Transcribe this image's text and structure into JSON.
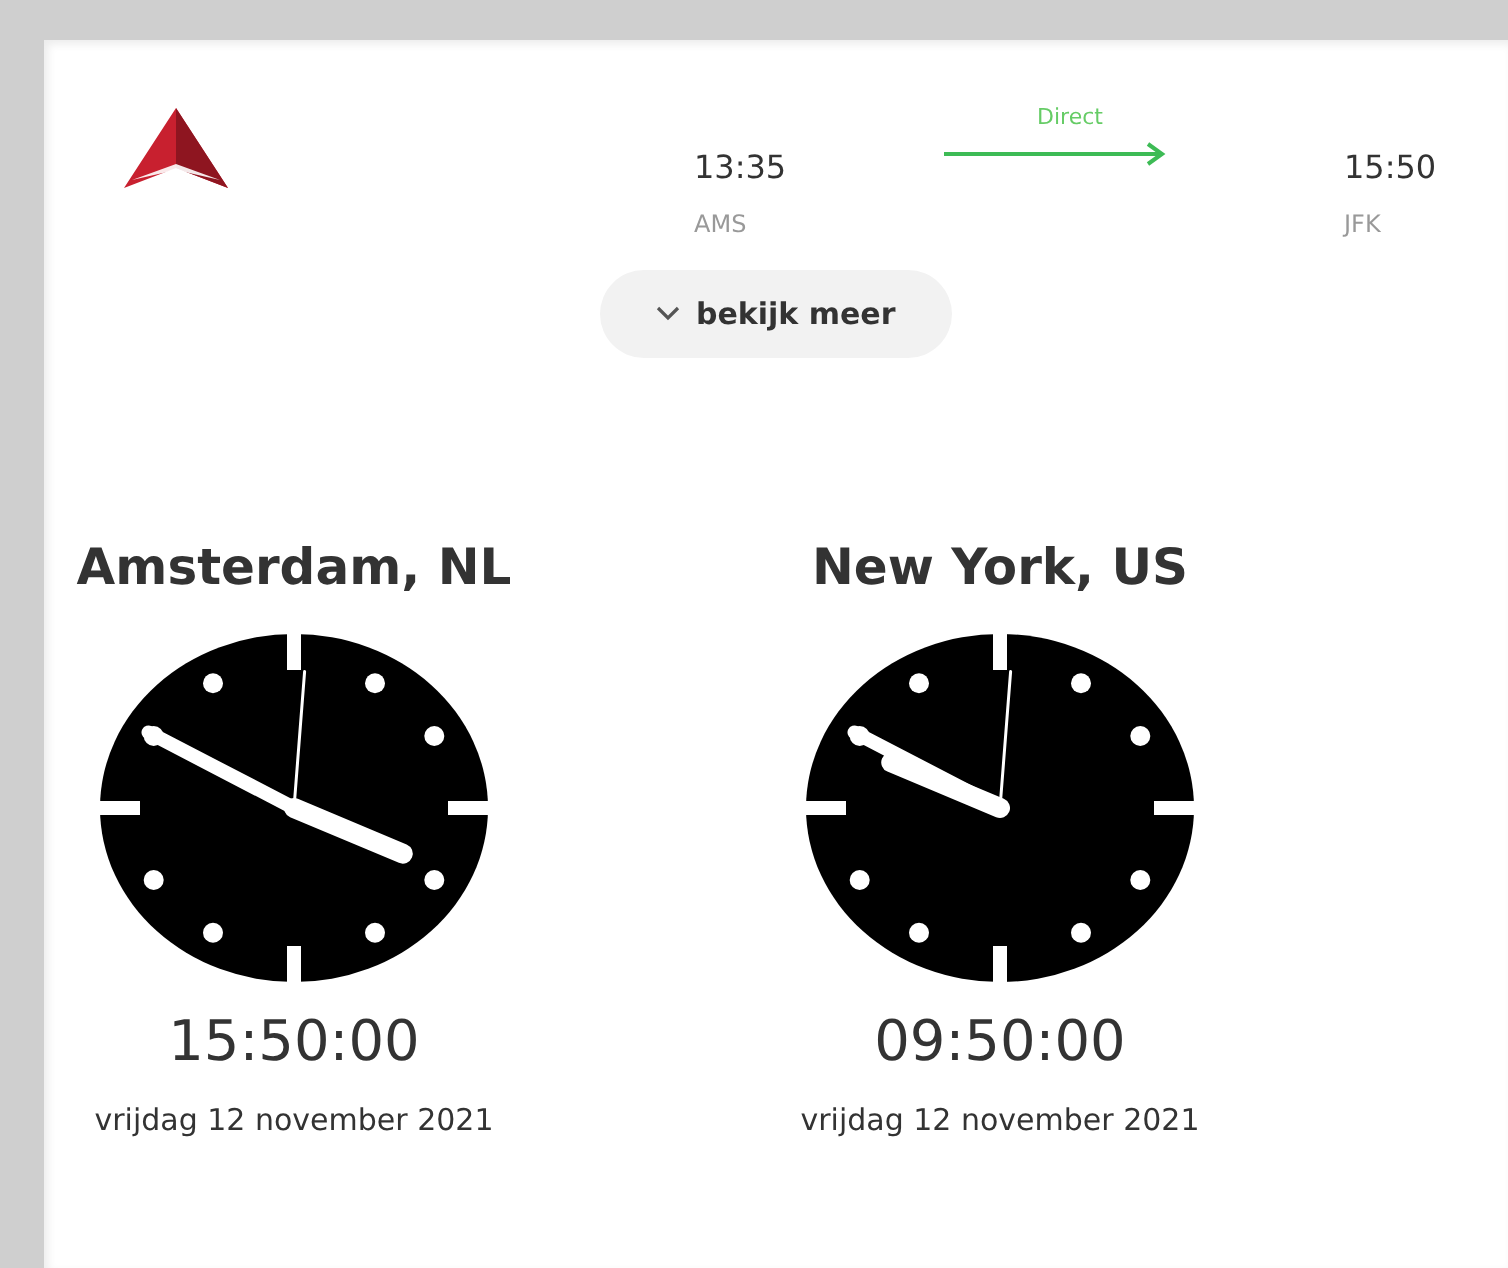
{
  "flight": {
    "departure": {
      "time": "13:35",
      "airport": "AMS"
    },
    "stop_type": "Direct",
    "arrival": {
      "time": "15:50",
      "airport": "JFK"
    }
  },
  "expand_button": {
    "label": "bekijk meer"
  },
  "clocks": [
    {
      "city": "Amsterdam, NL",
      "time": "15:50:00",
      "date": "vrijdag 12 november 2021"
    },
    {
      "city": "New York, US",
      "time": "09:50:00",
      "date": "vrijdag 12 november 2021"
    }
  ]
}
